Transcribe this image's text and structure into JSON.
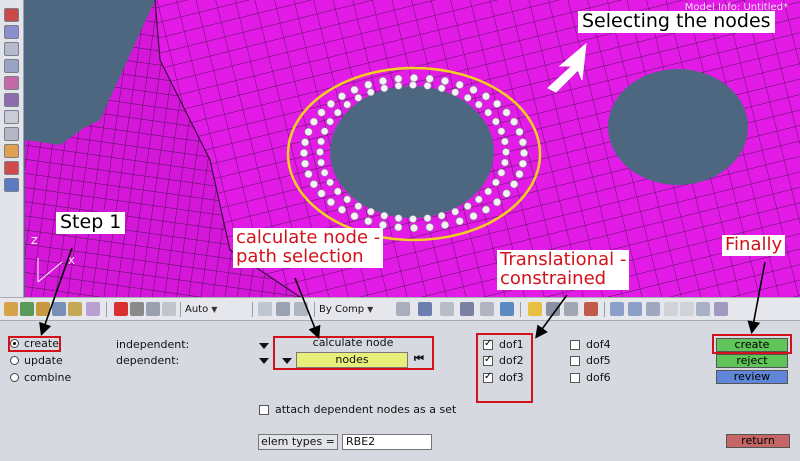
{
  "viewport": {
    "model_info": "Model Info: Untitled*",
    "axis_z": "Z",
    "axis_x": "X",
    "colors": {
      "mesh_surface": "#e21be6",
      "mesh_lines": "#55145a",
      "background": "#4e6780",
      "selection_ring": "#f5d020",
      "nodes": "#ffffff"
    }
  },
  "toolbar": {
    "combo_auto": "Auto",
    "combo_by_comp": "By Comp"
  },
  "panel": {
    "radios": [
      {
        "label": "create",
        "selected": true
      },
      {
        "label": "update",
        "selected": false
      },
      {
        "label": "combine",
        "selected": false
      }
    ],
    "independent_label": "independent:",
    "dependent_label": "dependent:",
    "independent_value": "calculate node",
    "dependent_value": "nodes",
    "dofs_left": [
      {
        "label": "dof1",
        "checked": true
      },
      {
        "label": "dof2",
        "checked": true
      },
      {
        "label": "dof3",
        "checked": true
      }
    ],
    "dofs_right": [
      {
        "label": "dof4",
        "checked": false
      },
      {
        "label": "dof5",
        "checked": false
      },
      {
        "label": "dof6",
        "checked": false
      }
    ],
    "attach_label": "attach dependent nodes as a set",
    "elem_types_label": "elem types =",
    "elem_types_value": "RBE2",
    "buttons": {
      "create": "create",
      "reject": "reject",
      "review": "review",
      "return": "return"
    },
    "colors": {
      "create": "#5fc45a",
      "reject": "#5fc45a",
      "review": "#5f86d8",
      "return": "#c56565",
      "nodes_field": "#e8ee7a"
    }
  },
  "annotations": {
    "selecting": "Selecting the nodes",
    "step1": "Step 1",
    "calc_node_1": "calculate node -",
    "calc_node_2": "path selection",
    "translational_1": "Translational -",
    "translational_2": "constrained",
    "finally": "Finally"
  }
}
